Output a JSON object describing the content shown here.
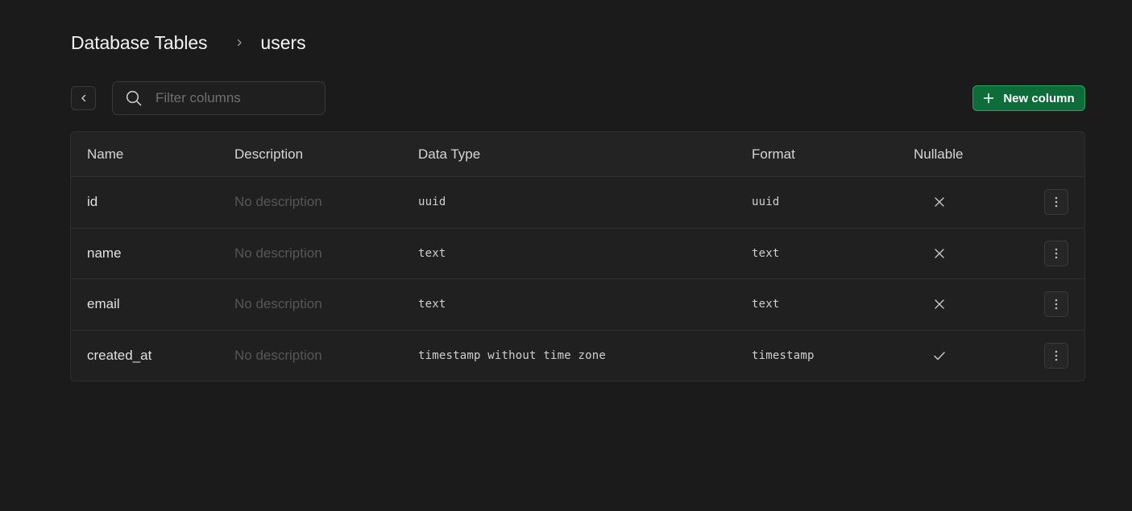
{
  "breadcrumb": {
    "root": "Database Tables",
    "current": "users"
  },
  "toolbar": {
    "back_icon": "chevron-left-icon",
    "search_placeholder": "Filter columns",
    "search_value": "",
    "new_column_label": "New column"
  },
  "table": {
    "headers": {
      "name": "Name",
      "description": "Description",
      "data_type": "Data Type",
      "format": "Format",
      "nullable": "Nullable"
    },
    "rows": [
      {
        "name": "id",
        "description": "No description",
        "data_type": "uuid",
        "format": "uuid",
        "nullable": false
      },
      {
        "name": "name",
        "description": "No description",
        "data_type": "text",
        "format": "text",
        "nullable": false
      },
      {
        "name": "email",
        "description": "No description",
        "data_type": "text",
        "format": "text",
        "nullable": false
      },
      {
        "name": "created_at",
        "description": "No description",
        "data_type": "timestamp without time zone",
        "format": "timestamp",
        "nullable": true
      }
    ]
  },
  "colors": {
    "background": "#1b1b1b",
    "table_background": "#202020",
    "accent_green": "#0e6b3a",
    "accent_green_border": "#2aa05c"
  }
}
